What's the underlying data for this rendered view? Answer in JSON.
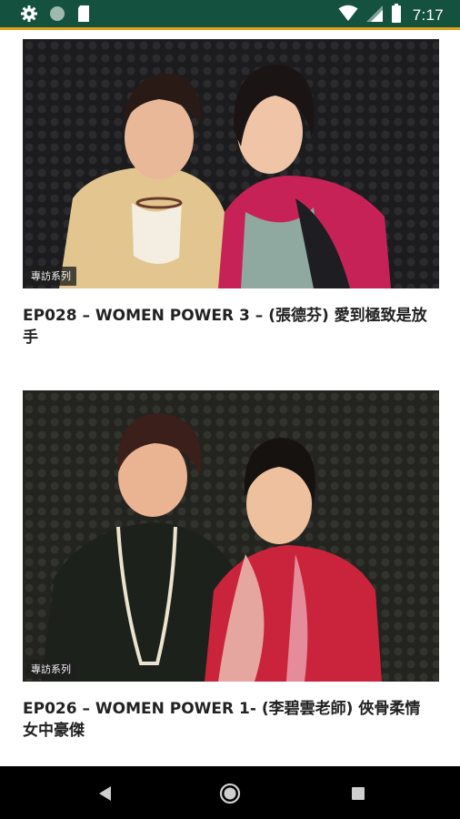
{
  "status_bar": {
    "time": "7:17",
    "left_icons": [
      "gear-icon",
      "circle-icon",
      "sim-card-icon"
    ],
    "right_icons": [
      "wifi-icon",
      "cellular-signal-icon",
      "battery-icon"
    ],
    "background": "#14523f",
    "accent": "#e0a21c"
  },
  "episodes": [
    {
      "tag": "專訪系列",
      "title": "EP028 – WOMEN POWER 3 – (張德芬) 愛到極致是放手"
    },
    {
      "tag": "專訪系列",
      "title": "EP026 – WOMEN POWER 1- (李碧雲老師) 俠骨柔情 女中豪傑"
    }
  ],
  "nav_bar": {
    "buttons": [
      "back-icon",
      "home-icon",
      "recents-icon"
    ]
  }
}
